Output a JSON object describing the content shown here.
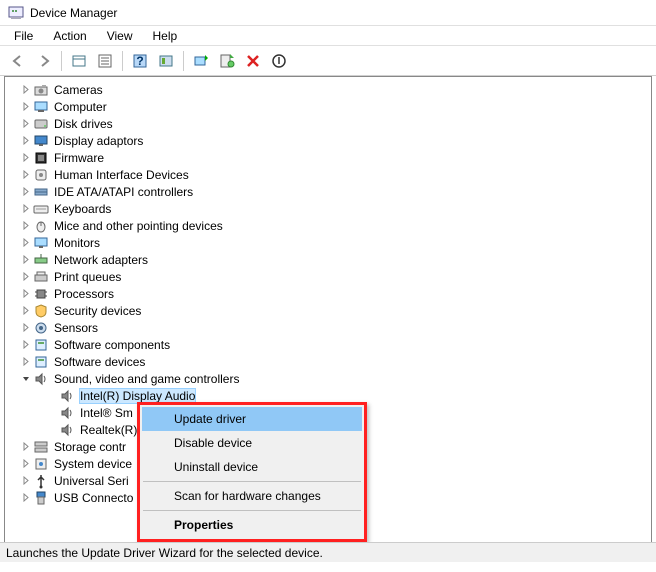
{
  "window": {
    "title": "Device Manager"
  },
  "menu": {
    "file": "File",
    "action": "Action",
    "view": "View",
    "help": "Help"
  },
  "toolbar_icons": {
    "back": "back-icon",
    "forward": "forward-icon",
    "show_hidden": "show-hidden-icon",
    "properties": "properties-icon",
    "help": "help-icon",
    "action_center": "action-icon",
    "monitor": "monitor-icon",
    "scan": "scan-hardware-icon",
    "remove": "remove-icon",
    "update": "update-driver-icon"
  },
  "tree": {
    "categories": [
      {
        "label": "Cameras",
        "icon": "camera-icon"
      },
      {
        "label": "Computer",
        "icon": "computer-icon"
      },
      {
        "label": "Disk drives",
        "icon": "disk-icon"
      },
      {
        "label": "Display adaptors",
        "icon": "display-icon"
      },
      {
        "label": "Firmware",
        "icon": "firmware-icon"
      },
      {
        "label": "Human Interface Devices",
        "icon": "hid-icon"
      },
      {
        "label": "IDE ATA/ATAPI controllers",
        "icon": "ide-icon"
      },
      {
        "label": "Keyboards",
        "icon": "keyboard-icon"
      },
      {
        "label": "Mice and other pointing devices",
        "icon": "mouse-icon"
      },
      {
        "label": "Monitors",
        "icon": "monitor-icon"
      },
      {
        "label": "Network adapters",
        "icon": "network-icon"
      },
      {
        "label": "Print queues",
        "icon": "printer-icon"
      },
      {
        "label": "Processors",
        "icon": "cpu-icon"
      },
      {
        "label": "Security devices",
        "icon": "security-icon"
      },
      {
        "label": "Sensors",
        "icon": "sensor-icon"
      },
      {
        "label": "Software components",
        "icon": "software-icon"
      },
      {
        "label": "Software devices",
        "icon": "software-icon"
      },
      {
        "label": "Sound, video and game controllers",
        "icon": "sound-icon",
        "expanded": true,
        "children": [
          {
            "label": "Intel(R) Display Audio",
            "icon": "sound-icon",
            "selected": true
          },
          {
            "label": "Intel® Sm",
            "icon": "sound-icon"
          },
          {
            "label": "Realtek(R)",
            "icon": "sound-icon"
          }
        ]
      },
      {
        "label": "Storage contr",
        "icon": "storage-icon"
      },
      {
        "label": "System device",
        "icon": "system-icon"
      },
      {
        "label": "Universal Seri",
        "icon": "usb-icon"
      },
      {
        "label": "USB Connecto",
        "icon": "usb-conn-icon"
      }
    ]
  },
  "context_menu": {
    "items": [
      {
        "label": "Update driver",
        "highlighted": true
      },
      {
        "label": "Disable device"
      },
      {
        "label": "Uninstall device"
      },
      {
        "separator": true
      },
      {
        "label": "Scan for hardware changes"
      },
      {
        "separator": true
      },
      {
        "label": "Properties",
        "bold": true
      }
    ]
  },
  "status": {
    "text": "Launches the Update Driver Wizard for the selected device."
  }
}
